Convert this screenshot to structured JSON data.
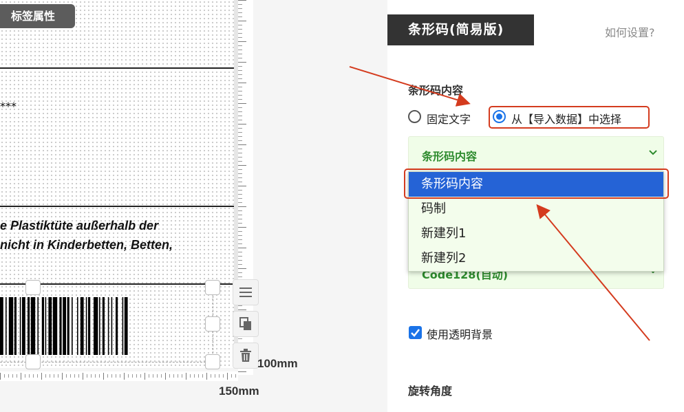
{
  "canvas": {
    "label_tag": "标签属性",
    "stars": "***",
    "text_line1": "e Plastiktüte außerhalb der",
    "text_line2": " nicht in Kinderbetten, Betten,",
    "dim_height": "100mm",
    "dim_width": "150mm"
  },
  "panel": {
    "title": "条形码(简易版)",
    "help": "如何设置?",
    "content_section": "条形码内容",
    "radio_fixed": "固定文字",
    "radio_import": "从【导入数据】中选择",
    "select_value": "条形码内容",
    "second_select_value": "Code128(自动)",
    "transparent_label": "使用透明背景",
    "rotation_section": "旋转角度"
  },
  "dropdown": {
    "options": [
      "条形码内容",
      "码制",
      "新建列1",
      "新建列2"
    ],
    "selected_index": 0
  },
  "colors": {
    "accent": "#1a73e8",
    "highlight": "#2563d6",
    "annotation": "#d43b1e",
    "select_bg": "#f0fde8",
    "select_text": "#2e8b2e"
  },
  "icons": [
    "list-icon",
    "copy-icon",
    "trash-icon",
    "chevron-down-icon",
    "checkmark-icon"
  ]
}
